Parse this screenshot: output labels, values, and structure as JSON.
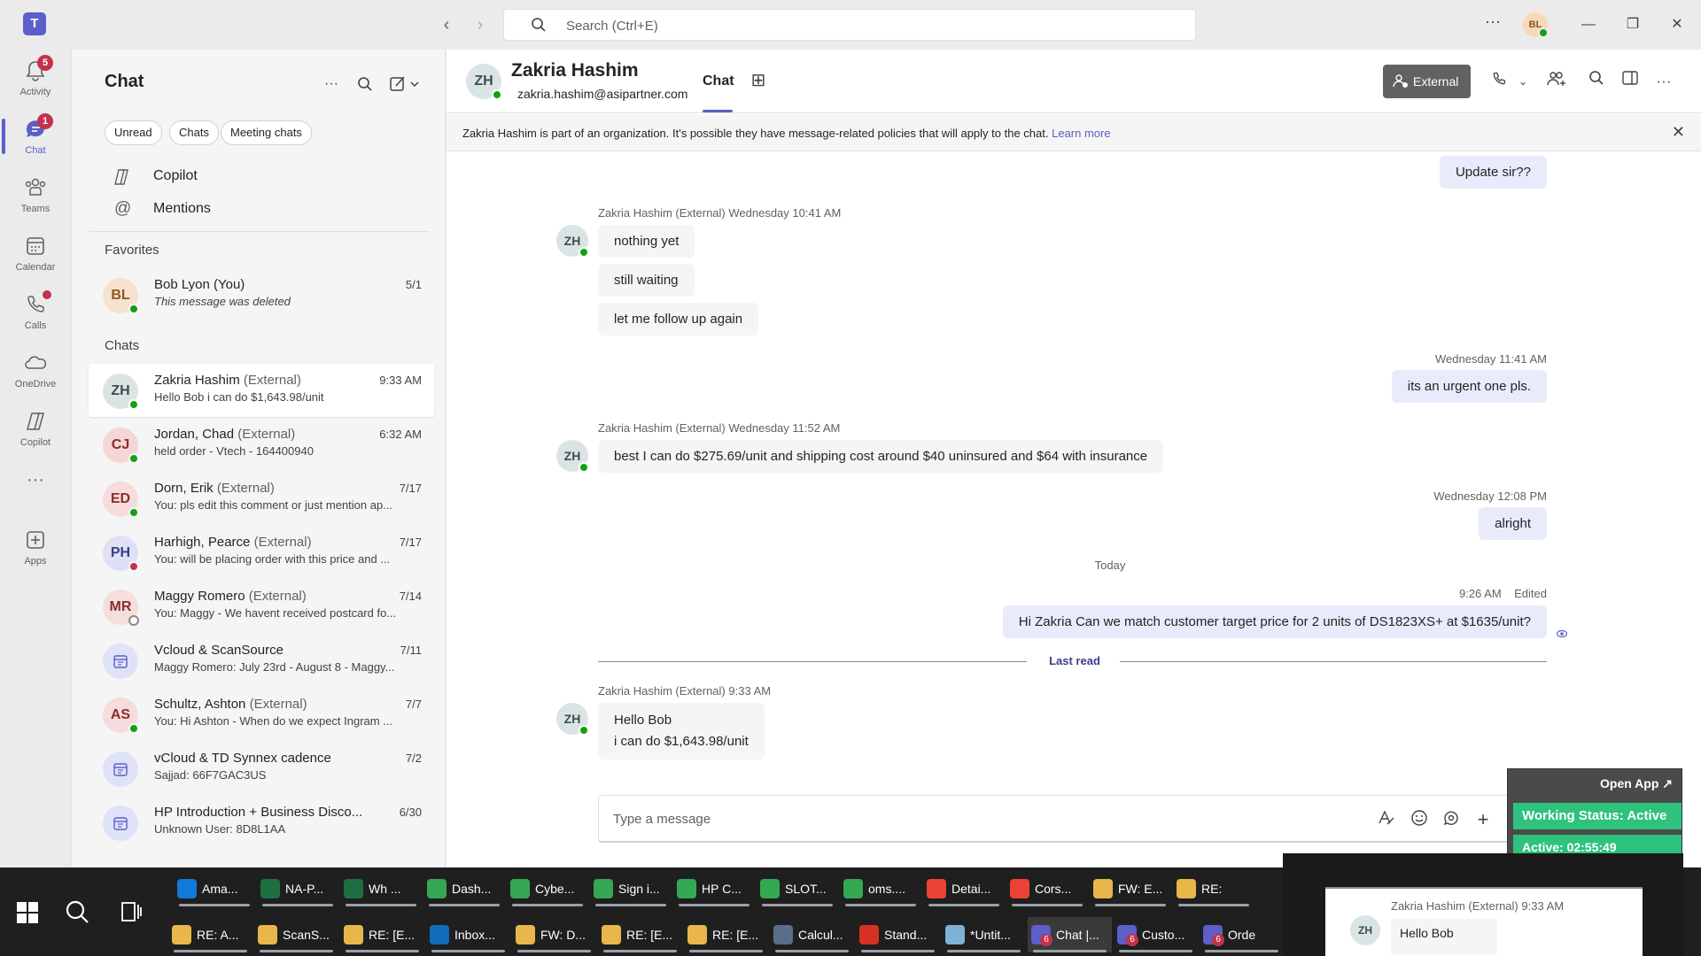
{
  "titlebar": {
    "search_placeholder": "Search (Ctrl+E)",
    "user_initials": "BL"
  },
  "rail": {
    "items": [
      {
        "label": "Activity",
        "badge": "5"
      },
      {
        "label": "Chat",
        "badge": "1"
      },
      {
        "label": "Teams"
      },
      {
        "label": "Calendar"
      },
      {
        "label": "Calls"
      },
      {
        "label": "OneDrive"
      },
      {
        "label": "Copilot"
      },
      {
        "label": "Apps"
      }
    ]
  },
  "chatlist": {
    "title": "Chat",
    "filters": [
      "Unread",
      "Chats",
      "Meeting chats"
    ],
    "nav": [
      {
        "label": "Copilot"
      },
      {
        "label": "Mentions"
      }
    ],
    "favorites_header": "Favorites",
    "favorites": [
      {
        "initials": "BL",
        "name": "Bob Lyon (You)",
        "ext": "",
        "preview": "This message was deleted",
        "time": "5/1",
        "presence": "green",
        "avatar_bg": "#f6e3cf",
        "avatar_fg": "#8a5a1e"
      }
    ],
    "chats_header": "Chats",
    "chats": [
      {
        "initials": "ZH",
        "name": "Zakria Hashim",
        "ext": "(External)",
        "preview": "Hello Bob i can do $1,643.98/unit",
        "time": "9:33 AM",
        "presence": "green",
        "avatar_bg": "#dbe4e4",
        "avatar_fg": "#3d4d4d"
      },
      {
        "initials": "CJ",
        "name": "Jordan, Chad",
        "ext": "(External)",
        "preview": "held order - Vtech -    164400940",
        "time": "6:32 AM",
        "presence": "green",
        "avatar_bg": "#f4d6d6",
        "avatar_fg": "#8a2d2d"
      },
      {
        "initials": "ED",
        "name": "Dorn, Erik",
        "ext": "(External)",
        "preview": "You: pls edit this comment or just mention ap...",
        "time": "7/17",
        "presence": "green",
        "avatar_bg": "#f6dcdc",
        "avatar_fg": "#8a2d2d"
      },
      {
        "initials": "PH",
        "name": "Harhigh, Pearce",
        "ext": "(External)",
        "preview": "You: will be placing order with this price and ...",
        "time": "7/17",
        "presence": "red",
        "avatar_bg": "#dfe0f5",
        "avatar_fg": "#3b3f8a"
      },
      {
        "initials": "MR",
        "name": "Maggy Romero",
        "ext": "(External)",
        "preview": "You: Maggy - We havent received postcard fo...",
        "time": "7/14",
        "presence": "off",
        "avatar_bg": "#f5dede",
        "avatar_fg": "#8a2d2d"
      },
      {
        "initials": "",
        "name": "Vcloud & ScanSource",
        "ext": "",
        "preview": "Maggy Romero: July 23rd - August 8 - Maggy...",
        "time": "7/11",
        "presence": "",
        "avatar_bg": "#e0e2f7",
        "avatar_fg": "#5b5fc7",
        "icon": "calendar-icon"
      },
      {
        "initials": "AS",
        "name": "Schultz, Ashton",
        "ext": "(External)",
        "preview": "You: Hi Ashton -  When do we expect Ingram ...",
        "time": "7/7",
        "presence": "green",
        "avatar_bg": "#f6dcdc",
        "avatar_fg": "#8a2d2d"
      },
      {
        "initials": "",
        "name": "vCloud & TD Synnex cadence",
        "ext": "",
        "preview": "Sajjad: 66F7GAC3US",
        "time": "7/2",
        "presence": "",
        "avatar_bg": "#e0e2f7",
        "avatar_fg": "#5b5fc7",
        "icon": "calendar-icon"
      },
      {
        "initials": "",
        "name": "HP Introduction + Business Disco...",
        "ext": "",
        "preview": "Unknown User: 8D8L1AA",
        "time": "6/30",
        "presence": "",
        "avatar_bg": "#e0e2f7",
        "avatar_fg": "#5b5fc7",
        "icon": "calendar-icon"
      }
    ]
  },
  "header": {
    "initials": "ZH",
    "name": "Zakria Hashim",
    "email": "zakria.hashim@asipartner.com",
    "tab": "Chat",
    "external_label": "External"
  },
  "banner": {
    "text": "Zakria Hashim is part of an organization. It's possible they have message-related policies that will apply to the chat.",
    "link": "Learn more"
  },
  "messages": {
    "out_update": "Update sir??",
    "grp1_header": "Zakria Hashim (External)   Wednesday 10:41 AM",
    "grp1": [
      "nothing yet",
      "still waiting",
      "let me follow up again"
    ],
    "out2_time": "Wednesday 11:41 AM",
    "out2": "its an urgent one pls.",
    "grp2_header": "Zakria Hashim (External)   Wednesday 11:52 AM",
    "grp2": "best I can do $275.69/unit and shipping cost around $40 uninsured and $64 with insurance",
    "out3_time": "Wednesday 12:08 PM",
    "out3": "alright",
    "today": "Today",
    "out4_time": "9:26 AM",
    "out4_edited": "Edited",
    "out4": "Hi Zakria Can we match customer target price for 2 units of DS1823XS+ at $1635/unit?",
    "last_read": "Last read",
    "grp3_header": "Zakria Hashim (External)   9:33 AM",
    "grp3_line1": "Hello Bob",
    "grp3_line2": "i can do $1,643.98/unit",
    "avatar_initials": "ZH"
  },
  "composer": {
    "placeholder": "Type a message"
  },
  "widget": {
    "open_app": "Open App ↗",
    "status": "Working Status: Active",
    "timer": "Active: 02:55:49"
  },
  "taskbar": {
    "row1": [
      {
        "label": "Ama...",
        "color": "#0f7ad8",
        "icon": "edge-icon"
      },
      {
        "label": "NA-P...",
        "color": "#1d6f42",
        "icon": "excel-icon"
      },
      {
        "label": "Wh ...",
        "color": "#1d6f42",
        "icon": "excel-icon"
      },
      {
        "label": "Dash...",
        "color": "#34a853",
        "icon": "chrome-icon"
      },
      {
        "label": "Cybe...",
        "color": "#34a853",
        "icon": "chrome-icon"
      },
      {
        "label": "Sign i...",
        "color": "#34a853",
        "icon": "chrome-icon"
      },
      {
        "label": "HP C...",
        "color": "#34a853",
        "icon": "chrome-icon"
      },
      {
        "label": "SLOT...",
        "color": "#34a853",
        "icon": "chrome-icon"
      },
      {
        "label": "oms....",
        "color": "#34a853",
        "icon": "chrome-icon"
      },
      {
        "label": "Detai...",
        "color": "#ea4335",
        "icon": "chrome-icon"
      },
      {
        "label": "Cors...",
        "color": "#ea4335",
        "icon": "chrome-icon"
      },
      {
        "label": "FW: E...",
        "color": "#e8b64a",
        "icon": "mail-icon"
      },
      {
        "label": "RE:",
        "color": "#e8b64a",
        "icon": "mail-icon"
      }
    ],
    "row2": [
      {
        "label": "RE: A...",
        "color": "#e8b64a",
        "icon": "mail-icon"
      },
      {
        "label": "ScanS...",
        "color": "#e8b64a",
        "icon": "mail-icon"
      },
      {
        "label": "RE: [E...",
        "color": "#e8b64a",
        "icon": "mail-icon"
      },
      {
        "label": "Inbox...",
        "color": "#0f6cbd",
        "icon": "outlook-icon"
      },
      {
        "label": "FW: D...",
        "color": "#e8b64a",
        "icon": "mail-icon"
      },
      {
        "label": "RE: [E...",
        "color": "#e8b64a",
        "icon": "mail-icon"
      },
      {
        "label": "RE: [E...",
        "color": "#e8b64a",
        "icon": "mail-icon"
      },
      {
        "label": "Calcul...",
        "color": "#5a6e8a",
        "icon": "calculator-icon"
      },
      {
        "label": "Stand...",
        "color": "#d93025",
        "icon": "pdf-icon"
      },
      {
        "label": "*Untit...",
        "color": "#7fb3d5",
        "icon": "notepad-icon"
      },
      {
        "label": "Chat |...",
        "color": "#5b5fc7",
        "icon": "teams-icon",
        "count": "6",
        "active": true
      },
      {
        "label": "Custo...",
        "color": "#5b5fc7",
        "icon": "teams-icon",
        "count": "6"
      },
      {
        "label": "Orde",
        "color": "#5b5fc7",
        "icon": "teams-icon",
        "count": "6"
      }
    ],
    "preview_header": "Zakria Hashim (External)   9:33 AM",
    "preview_initials": "ZH",
    "preview_text": "Hello Bob"
  },
  "colors": {
    "accent": "#5b5fc7",
    "presence_available": "#13a10e",
    "presence_busy": "#c4314b",
    "badge": "#c4314b",
    "outgoing_bubble": "#e8ebfa"
  }
}
